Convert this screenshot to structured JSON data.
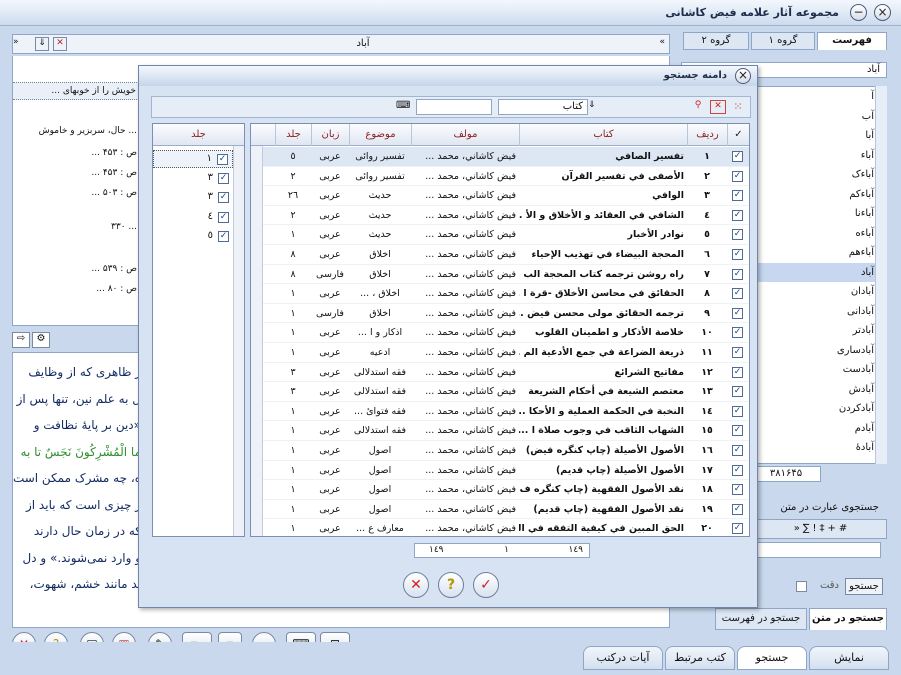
{
  "app": {
    "title": "مجموعه آثار علامه فیض کاشانی"
  },
  "right": {
    "tabs": [
      "فهرست",
      "گروه ۱",
      "گروه ۲"
    ],
    "search_value": "آباد",
    "items": [
      "آ",
      "آب",
      "آبا",
      "آباء",
      "آباءک",
      "آباءکم",
      "آباءنا",
      "آباءه",
      "آباءهم",
      "آباد",
      "آبادان",
      "آبادانی",
      "آبادتر",
      "آبادساری",
      "آبادست",
      "آبادش",
      "آبادکردن",
      "آبادم",
      "آبادهٔ"
    ],
    "selected_index": 9,
    "count": "۳۸۱۶۴۵",
    "search_in_text_label": "جستجوی عبارت در متن",
    "search_button": "جستجو",
    "exact_label": "دقت",
    "lower_tabs": [
      "جستجو در متن",
      "جستجو در فهرست"
    ]
  },
  "left": {
    "header_value": "آباد",
    "snippet": "... خویش را از خوبهای",
    "lines": [
      "حال، سربزیر و خاموش ...",
      "... ص : ۴۵۳",
      "... ص : ۴۵۳",
      "... ص : ۵۰۳",
      "۳۳۰ ...",
      "... ص : ۵۳۹",
      "... ص : ۸۰"
    ],
    "text_lines": [
      "ز ظاهری که از وظایف",
      "ل به علم نین، تنها پس از",
      "«دین بر پایهٔ نظافت و",
      "ما الْمُشْرِكُونَ نَجَسٌ تا به",
      "ه، چه مشرک ممکن است",
      "ر چیزی است که باید از",
      "که در زمان حال دارند",
      "و وارد نمی‌شوند.» و دل",
      "ید مانند خشم، شهوت،"
    ]
  },
  "dialog": {
    "title": "دامنه جستجو",
    "combo_value": "کتاب",
    "columns": {
      "check": "✓",
      "row": "ردیف",
      "book": "کتاب",
      "author": "مولف",
      "subject": "موضوع",
      "lang": "زبان",
      "vol": "جلد"
    },
    "jild_header": "جلد",
    "jild_items": [
      "۱",
      "۳",
      "۳",
      "٤",
      "٥"
    ],
    "rows": [
      {
        "n": "۱",
        "book": "تفسير الصافي",
        "author": "فيض كاشاني، محمد ...",
        "subject": "تفسير روائی",
        "lang": "عربی",
        "vol": "٥"
      },
      {
        "n": "۲",
        "book": "الأصفى في تفسير القرآن",
        "author": "فيض كاشاني، محمد ...",
        "subject": "تفسير روائی",
        "lang": "عربی",
        "vol": "۲"
      },
      {
        "n": "۳",
        "book": "الوافي",
        "author": "فيض كاشاني، محمد ...",
        "subject": "حديث",
        "lang": "عربی",
        "vol": "۲٦"
      },
      {
        "n": "٤",
        "book": "الشافي في العقائد و الأخلاق و الأ ...",
        "author": "فيض كاشاني، محمد ...",
        "subject": "حديث",
        "lang": "عربی",
        "vol": "۲"
      },
      {
        "n": "٥",
        "book": "نوادر الأخبار",
        "author": "فيض كاشاني، محمد ...",
        "subject": "حديث",
        "lang": "عربی",
        "vol": "۱"
      },
      {
        "n": "٦",
        "book": "المحجة البيضاء في تهذيب الإحياء",
        "author": "فيض كاشاني، محمد ...",
        "subject": "اخلاق",
        "lang": "عربی",
        "vol": "۸"
      },
      {
        "n": "۷",
        "book": "راه روشن ترجمه كتاب المحجة الب ...",
        "author": "فيض كاشاني، محمد ...",
        "subject": "اخلاق",
        "lang": "فارسی",
        "vol": "۸"
      },
      {
        "n": "۸",
        "book": "الحقائق في محاسن الأخلاق -قرة ا ...",
        "author": "فيض كاشاني، محمد ...",
        "subject": "اخلاق ، ...",
        "lang": "عربی",
        "vol": "۱"
      },
      {
        "n": "۹",
        "book": "ترجمه الحقائق مولى محسن فيض ...",
        "author": "فيض كاشاني، محمد ...",
        "subject": "اخلاق",
        "lang": "فارسی",
        "vol": "۱"
      },
      {
        "n": "۱۰",
        "book": "خلاصة الأذكار و اطمينان القلوب",
        "author": "فيض كاشاني، محمد ...",
        "subject": "اذكار و ا ...",
        "lang": "عربی",
        "vol": "۱"
      },
      {
        "n": "۱۱",
        "book": "ذريعة الضراعة في جمع الأدعية الم ...",
        "author": "فيض كاشاني، محمد ...",
        "subject": "ادعيه",
        "lang": "عربی",
        "vol": "۱"
      },
      {
        "n": "۱۲",
        "book": "مفاتيح الشرائع",
        "author": "فيض كاشاني، محمد ...",
        "subject": "فقه استدلالی",
        "lang": "عربی",
        "vol": "۳"
      },
      {
        "n": "۱۳",
        "book": "معتصم الشيعة في أحكام الشريعة",
        "author": "فيض كاشاني، محمد ...",
        "subject": "فقه استدلالی",
        "lang": "عربی",
        "vol": "۳"
      },
      {
        "n": "۱٤",
        "book": "النخبة في الحكمة العملية و الأحكا ...",
        "author": "فيض كاشاني، محمد ...",
        "subject": "فقه فتوائ ...",
        "lang": "عربی",
        "vol": "۱"
      },
      {
        "n": "۱٥",
        "book": "الشهاب الثاقب في وجوب صلاة ا ...",
        "author": "فيض كاشاني، محمد ...",
        "subject": "فقه استدلالی",
        "lang": "عربی",
        "vol": "۱"
      },
      {
        "n": "۱٦",
        "book": "الأصول الأصيلة (چاپ كنگره فيض)",
        "author": "فيض كاشاني، محمد ...",
        "subject": "اصول",
        "lang": "عربی",
        "vol": "۱"
      },
      {
        "n": "۱۷",
        "book": "الأصول الأصيلة (چاپ قديم)",
        "author": "فيض كاشاني، محمد ...",
        "subject": "اصول",
        "lang": "عربی",
        "vol": "۱"
      },
      {
        "n": "۱۸",
        "book": "نقد الأصول الفقهية (چاپ كنگره ف ...",
        "author": "فيض كاشاني، محمد ...",
        "subject": "اصول",
        "lang": "عربی",
        "vol": "۱"
      },
      {
        "n": "۱۹",
        "book": "نقد الأصول الفقهية (چاپ قديم)",
        "author": "فيض كاشاني، محمد ...",
        "subject": "اصول",
        "lang": "عربی",
        "vol": "۱"
      },
      {
        "n": "۲۰",
        "book": "الحق المبين في كيفية التفقه في الدين",
        "author": "فيض كاشاني، محمد ...",
        "subject": "معارف ع ...",
        "lang": "عربی",
        "vol": "۱"
      }
    ],
    "pager": {
      "total": "۱٤۹",
      "from": "۱",
      "to": "۱٤۹"
    }
  },
  "bottom_tabs": [
    "نمایش",
    "جستجو",
    "کتب مرتبط",
    "آیات درکتب"
  ],
  "colors": {
    "accent": "#8a1f1f",
    "bg": "#c9d8ec",
    "selection": "#c6d7ef"
  }
}
